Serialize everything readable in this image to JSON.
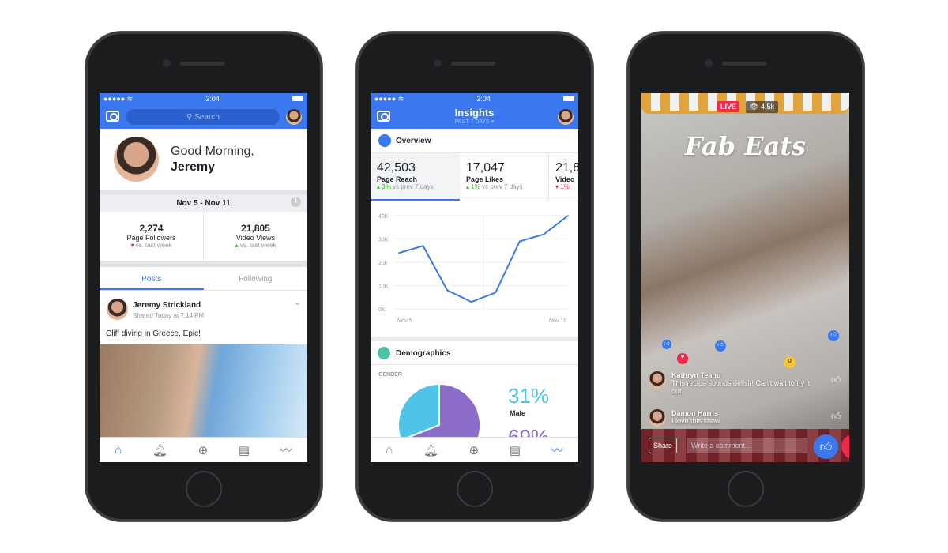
{
  "status": {
    "time": "2:04"
  },
  "home": {
    "search_placeholder": "Search",
    "greeting": "Good Morning,",
    "name": "Jeremy",
    "date_range": "Nov 5 - Nov 11",
    "stats": [
      {
        "value": "2,274",
        "label": "Page Followers",
        "trend": "down",
        "compare": "vs. last week"
      },
      {
        "value": "21,805",
        "label": "Video Views",
        "trend": "up",
        "compare": "vs. last week"
      }
    ],
    "tabs": [
      "Posts",
      "Following"
    ],
    "post": {
      "author": "Jeremy Strickland",
      "meta": "Shared Today at 7:14 PM",
      "text": "Cliff diving in Greece. Epic!"
    }
  },
  "insights": {
    "title": "Insights",
    "period": "PAST 7 DAYS",
    "overview_label": "Overview",
    "metrics": [
      {
        "value": "42,503",
        "label": "Page Reach",
        "change": "3%",
        "compare": "vs prev 7 days",
        "trend": "up"
      },
      {
        "value": "17,047",
        "label": "Page Likes",
        "change": "1%",
        "compare": "vs prev 7 days",
        "trend": "up"
      },
      {
        "value": "21,8",
        "label": "Video",
        "change": "1%",
        "trend": "down"
      }
    ],
    "demographics_label": "Demographics",
    "gender_label": "GENDER",
    "male_pct": "31%",
    "male_label": "Male",
    "female_pct": "69%"
  },
  "chart_data": {
    "type": "line",
    "x_labels": [
      "Nov 5",
      "Nov 11"
    ],
    "y_ticks": [
      "0K",
      "10K",
      "20k",
      "30K",
      "40K"
    ],
    "ylim": [
      0,
      40000
    ],
    "values": [
      24000,
      27000,
      8000,
      3000,
      7000,
      29000,
      32000,
      40000
    ],
    "color": "#3b78f0",
    "grid": true
  },
  "pie": {
    "male": 31,
    "female": 69,
    "male_color": "#4fc3e8",
    "female_color": "#8b6cc9"
  },
  "live": {
    "badge": "LIVE",
    "viewers": "4.5k",
    "show_title": "Fab Eats",
    "comments": [
      {
        "author": "Kathryn Teanu",
        "text": "This recipe sounds delish! Can't wait to try it out."
      },
      {
        "author": "Damon Harris",
        "text": "I love this show"
      }
    ],
    "share_label": "Share",
    "comment_placeholder": "Write a comment..."
  },
  "colors": {
    "brand": "#3b78f0",
    "up": "#42b72a",
    "down": "#f02849",
    "live": "#f02849"
  }
}
